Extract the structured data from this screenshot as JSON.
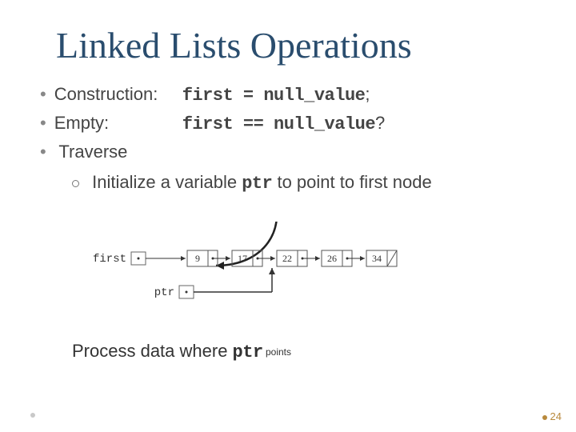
{
  "title": "Linked Lists Operations",
  "bullets": {
    "b1": {
      "label": "Construction:",
      "code": "first = null_value",
      "suffix": ";"
    },
    "b2": {
      "label": "Empty:",
      "code": "first == null_value",
      "suffix": "?"
    },
    "b3": {
      "label": "Traverse"
    },
    "b3a_pre": "Initialize a variable ",
    "b3a_code": "ptr",
    "b3a_post": " to point to first node",
    "b3b_pre": "Process data where ",
    "b3b_code": "ptr",
    "b3b_post": " points"
  },
  "diagram": {
    "first_label": "first",
    "ptr_label": "ptr",
    "nodes": [
      "9",
      "17",
      "22",
      "26",
      "34"
    ]
  },
  "page_number": "24"
}
